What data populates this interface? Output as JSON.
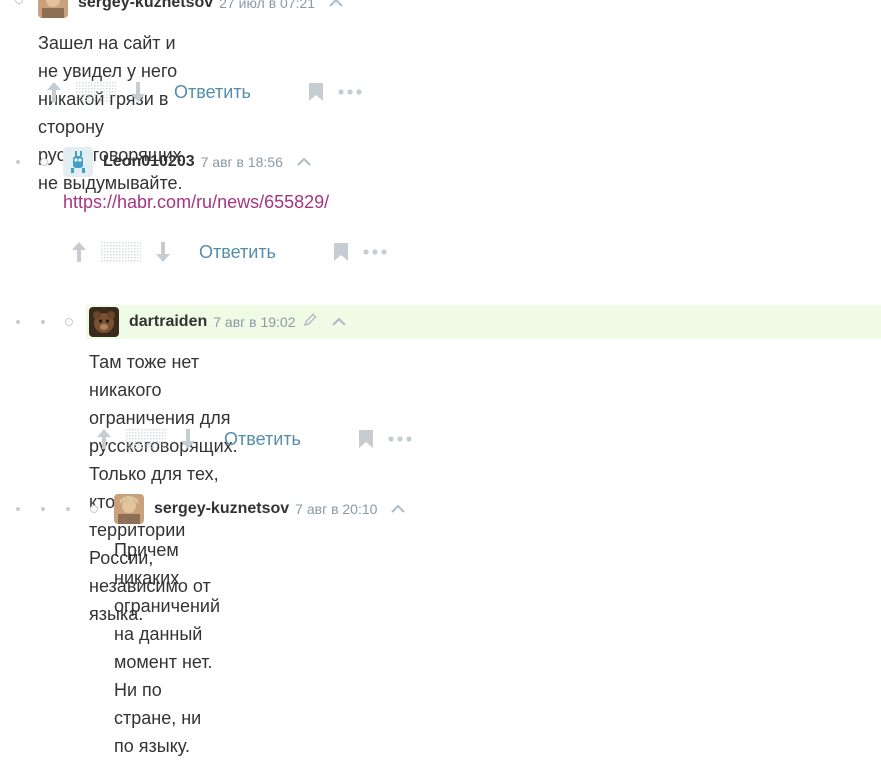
{
  "comments": [
    {
      "username": "sergey-kuznetsov",
      "time": "27 июл в 07:21",
      "body": "Зашел на сайт и не увидел у него никакой грязи в сторону русскоговорящих, не выдумывайте.",
      "reply_label": "Ответить"
    },
    {
      "username": "Leon010203",
      "time": "7 авг в 18:56",
      "link": "https://habr.com/ru/news/655829/",
      "reply_label": "Ответить"
    },
    {
      "username": "dartraiden",
      "time": "7 авг в 19:02",
      "body_line1": "Там тоже нет никакого ограничения для русскоговорящих. Только для тех, кто на",
      "body_line2": "территории России, независимо от языка.",
      "reply_label": "Ответить"
    },
    {
      "username": "sergey-kuznetsov",
      "time": "7 авг в 20:10",
      "body": "Причем никаких ограничений на данный момент нет. Ни по стране, ни по языку."
    }
  ],
  "colors": {
    "link": "#a33585",
    "reply": "#548eaa",
    "icon": "#c5cdd3",
    "time": "#8a9aa4",
    "highlight": "#f0fbe5"
  }
}
